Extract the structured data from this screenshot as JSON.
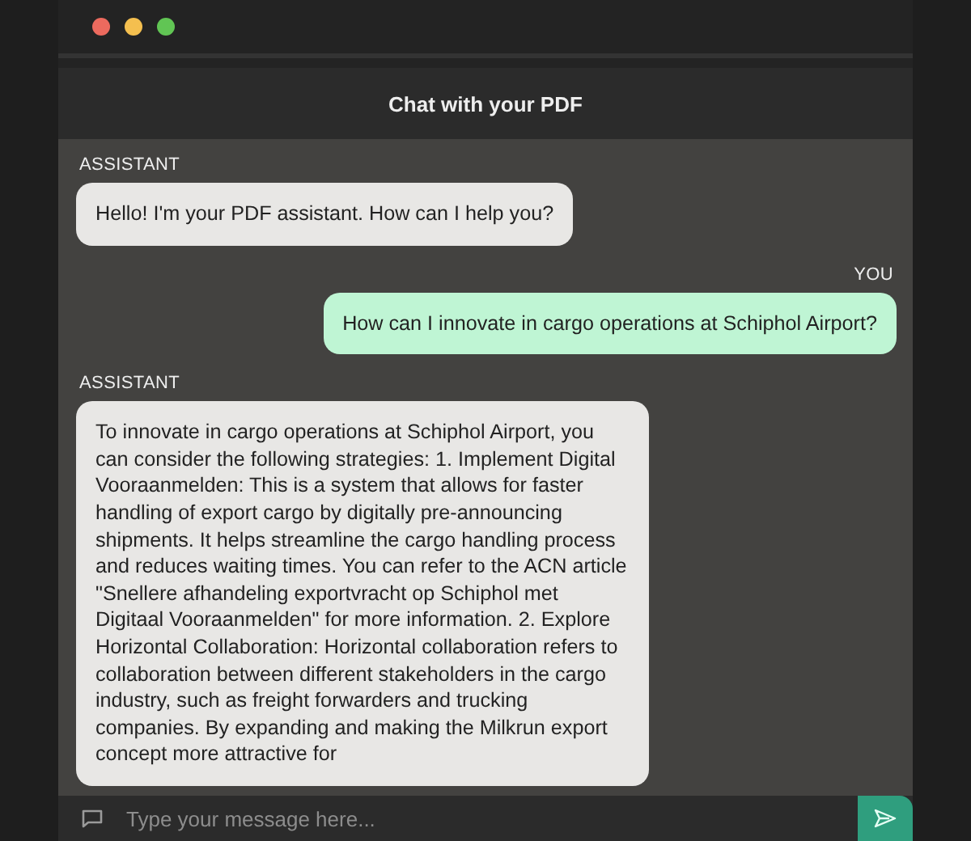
{
  "window": {
    "title": "Chat with your PDF"
  },
  "messages": [
    {
      "kind": "assistant",
      "sender": "ASSISTANT",
      "text": "Hello! I'm your PDF assistant. How can I help you?"
    },
    {
      "kind": "user",
      "sender": "YOU",
      "text": "How can I innovate in cargo operations at Schiphol Airport?"
    },
    {
      "kind": "assistant",
      "sender": "ASSISTANT",
      "text": "To innovate in cargo operations at Schiphol Airport, you can consider the following strategies: 1. Implement Digital Vooraanmelden: This is a system that allows for faster handling of export cargo by digitally pre-announcing shipments. It helps streamline the cargo handling process and reduces waiting times. You can refer to the ACN article \"Snellere afhandeling exportvracht op Schiphol met Digitaal Vooraanmelden\" for more information. 2. Explore Horizontal Collaboration: Horizontal collaboration refers to collaboration between different stakeholders in the cargo industry, such as freight forwarders and trucking companies. By expanding and making the Milkrun export concept more attractive for"
    }
  ],
  "composer": {
    "placeholder": "Type your message here..."
  }
}
